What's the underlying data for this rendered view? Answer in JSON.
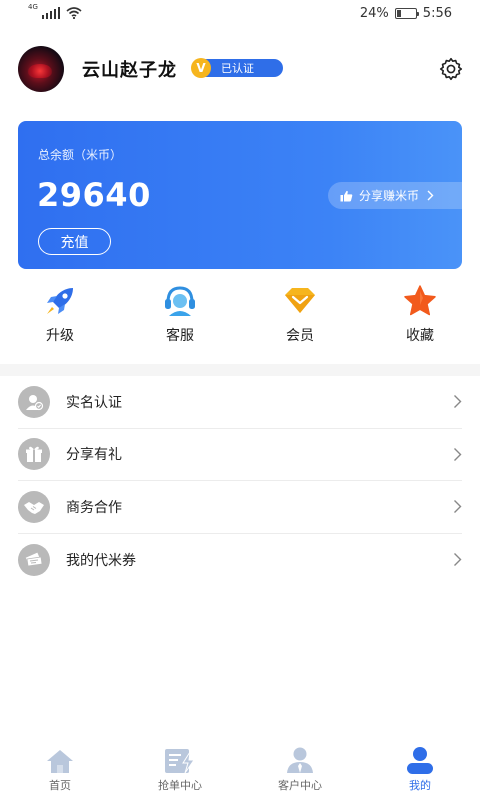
{
  "status_bar": {
    "network": "4G",
    "battery": "24%",
    "battery_level": 0.24,
    "time": "5:56"
  },
  "profile": {
    "username": "云山赵子龙",
    "badge_letter": "V",
    "verified_label": "已认证"
  },
  "balance": {
    "label": "总余额（米币）",
    "amount": "29640",
    "recharge_label": "充值",
    "share_label": "分享赚米币"
  },
  "quick_actions": [
    {
      "label": "升级",
      "icon": "rocket-icon"
    },
    {
      "label": "客服",
      "icon": "headset-icon"
    },
    {
      "label": "会员",
      "icon": "member-gem-icon"
    },
    {
      "label": "收藏",
      "icon": "star-icon"
    }
  ],
  "menu": [
    {
      "label": "实名认证",
      "icon": "id-verify-icon"
    },
    {
      "label": "分享有礼",
      "icon": "gift-icon"
    },
    {
      "label": "商务合作",
      "icon": "handshake-icon"
    },
    {
      "label": "我的代米券",
      "icon": "coupon-icon"
    }
  ],
  "nav": [
    {
      "label": "首页",
      "icon": "home-icon",
      "active": false
    },
    {
      "label": "抢单中心",
      "icon": "order-grab-icon",
      "active": false
    },
    {
      "label": "客户中心",
      "icon": "customer-icon",
      "active": false
    },
    {
      "label": "我的",
      "icon": "profile-icon",
      "active": true
    }
  ],
  "colors": {
    "primary": "#2f6ee8",
    "gold": "#f6b51e",
    "orange": "#f25a1c",
    "inactive_icon": "#b9c7dc"
  }
}
